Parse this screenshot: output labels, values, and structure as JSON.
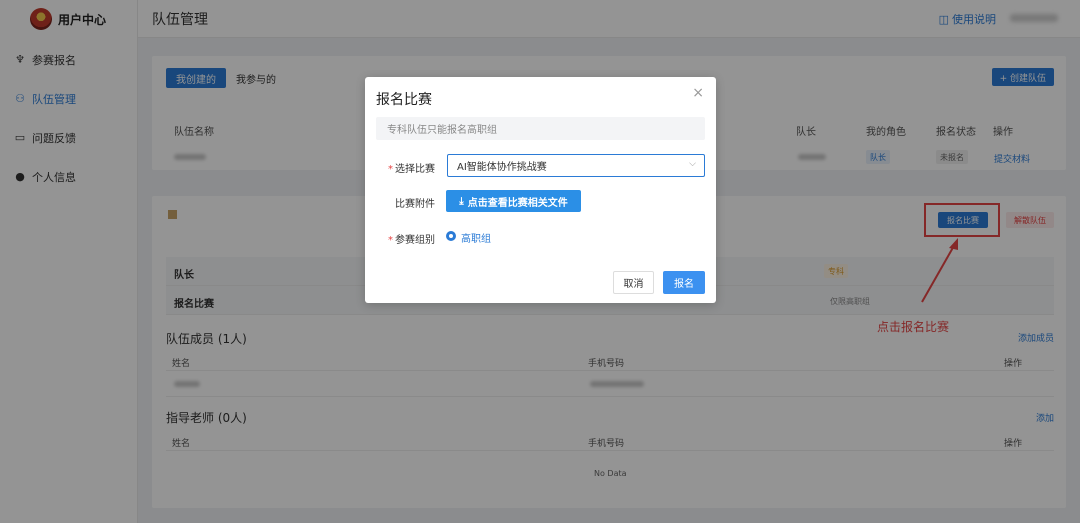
{
  "brand": {
    "title": "用户中心"
  },
  "sidebar": {
    "items": [
      {
        "label": "参赛报名",
        "icon": "trophy-icon"
      },
      {
        "label": "队伍管理",
        "icon": "user-icon"
      },
      {
        "label": "问题反馈",
        "icon": "chat-icon"
      },
      {
        "label": "个人信息",
        "icon": "person-icon"
      }
    ]
  },
  "header": {
    "title": "队伍管理",
    "help": "使用说明"
  },
  "teams": {
    "tabs": [
      "我创建的",
      "我参与的"
    ],
    "create_button": "+ 创建队伍",
    "columns": [
      "队伍名称",
      "队长",
      "我的角色",
      "报名状态",
      "操作"
    ],
    "row": {
      "role": "队长",
      "status": "未报名",
      "action": "提交材料"
    }
  },
  "detail": {
    "signup_button": "报名比赛",
    "dissolve_button": "解散队伍",
    "rows": [
      {
        "label": "队长",
        "tag": "专科"
      },
      {
        "label": "报名比赛",
        "note": "仅限高职组"
      }
    ],
    "members": {
      "title": "队伍成员 (1人)",
      "link": "添加成员",
      "col_name": "姓名",
      "col_phone": "手机号码",
      "col_action": "操作"
    },
    "teachers": {
      "title": "指导老师 (0人)",
      "link": "添加",
      "col_name": "姓名",
      "col_phone": "手机号码",
      "col_action": "操作",
      "empty": "No Data"
    }
  },
  "annotation": "点击报名比赛",
  "modal": {
    "title": "报名比赛",
    "close": "×",
    "notice": "专科队伍只能报名高职组",
    "select_label": "选择比赛",
    "select_value": "AI智能体协作挑战赛",
    "attach_label": "比赛附件",
    "attach_button": "点击查看比赛相关文件",
    "group_label": "参赛组别",
    "group_value": "高职组",
    "cancel": "取消",
    "submit": "报名"
  },
  "colors": {
    "accent": "#2b7bd6",
    "danger": "#e64545"
  }
}
